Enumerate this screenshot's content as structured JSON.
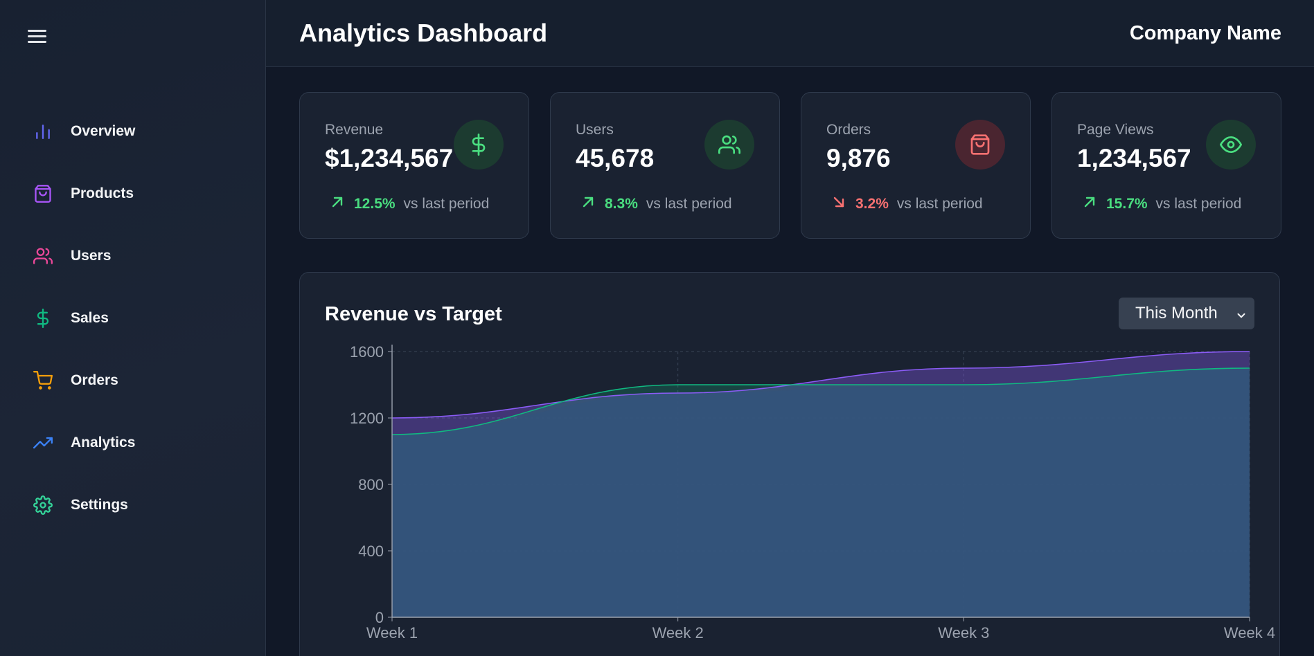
{
  "sidebar": {
    "menu_icon": "hamburger-icon",
    "items": [
      {
        "label": "Overview",
        "icon": "bar-chart-icon",
        "color": "#6366f1"
      },
      {
        "label": "Products",
        "icon": "shopping-bag-icon",
        "color": "#a855f7"
      },
      {
        "label": "Users",
        "icon": "users-icon",
        "color": "#ec4899"
      },
      {
        "label": "Sales",
        "icon": "dollar-icon",
        "color": "#10b981"
      },
      {
        "label": "Orders",
        "icon": "cart-icon",
        "color": "#f59e0b"
      },
      {
        "label": "Analytics",
        "icon": "trending-up-icon",
        "color": "#3b82f6"
      },
      {
        "label": "Settings",
        "icon": "gear-icon",
        "color": "#34d399"
      }
    ]
  },
  "header": {
    "title": "Analytics Dashboard",
    "company": "Company Name"
  },
  "stats": [
    {
      "label": "Revenue",
      "value": "$1,234,567",
      "change": "12.5%",
      "trend": "up",
      "suffix": "vs last period",
      "icon": "dollar-icon",
      "accent": "#4ade80",
      "icon_bg": "#1c3b30"
    },
    {
      "label": "Users",
      "value": "45,678",
      "change": "8.3%",
      "trend": "up",
      "suffix": "vs last period",
      "icon": "users-icon",
      "accent": "#4ade80",
      "icon_bg": "#1c3b30"
    },
    {
      "label": "Orders",
      "value": "9,876",
      "change": "3.2%",
      "trend": "down",
      "suffix": "vs last period",
      "icon": "shopping-bag-icon",
      "accent": "#f87171",
      "icon_bg": "#4a2530"
    },
    {
      "label": "Page Views",
      "value": "1,234,567",
      "change": "15.7%",
      "trend": "up",
      "suffix": "vs last period",
      "icon": "eye-icon",
      "accent": "#4ade80",
      "icon_bg": "#1c3b30"
    }
  ],
  "chart": {
    "title": "Revenue vs Target",
    "period_select": {
      "selected": "This Month"
    }
  },
  "chart_data": {
    "type": "area",
    "title": "Revenue vs Target",
    "categories": [
      "Week 1",
      "Week 2",
      "Week 3",
      "Week 4"
    ],
    "series": [
      {
        "values": [
          1200,
          1350,
          1500,
          1600
        ],
        "color": "#8b5cf6"
      },
      {
        "values": [
          1100,
          1400,
          1400,
          1500
        ],
        "color": "#10b981"
      }
    ],
    "ylim": [
      0,
      1600
    ],
    "yticks": [
      "0",
      "400",
      "800",
      "1200",
      "1600"
    ],
    "grid": true,
    "legend": "none"
  }
}
